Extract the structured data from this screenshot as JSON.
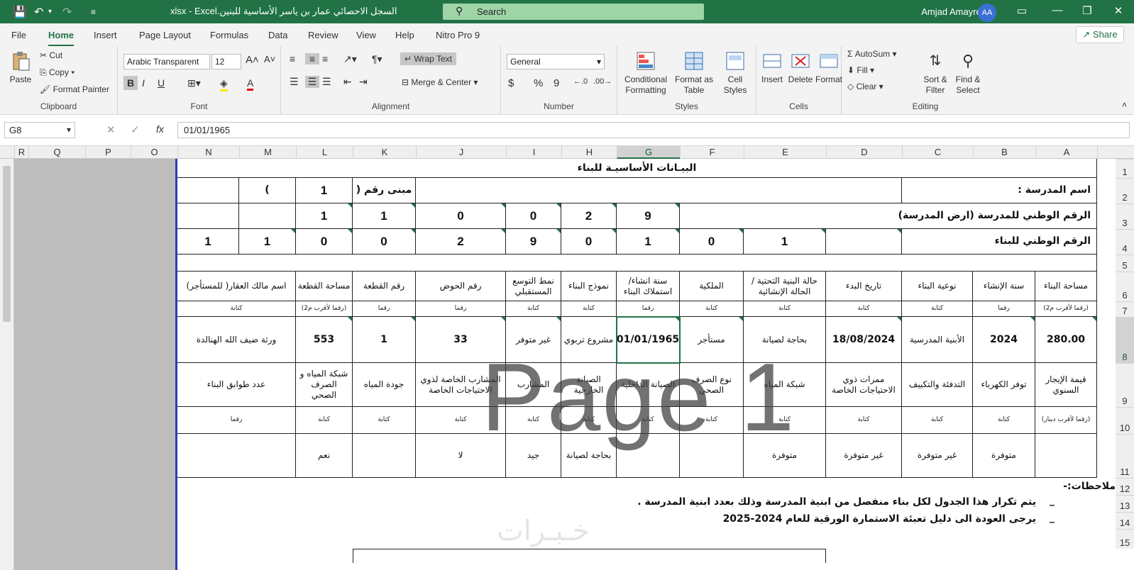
{
  "window": {
    "doc_title": "السجل الاحصائي عمار بن ياسر الأساسية للبنين.xlsx  -  Excel",
    "search_placeholder": "Search",
    "user_name": "Amjad Amayreh",
    "user_initials": "AA"
  },
  "menu": {
    "tabs": [
      "File",
      "Home",
      "Insert",
      "Page Layout",
      "Formulas",
      "Data",
      "Review",
      "View",
      "Help",
      "Nitro Pro 9"
    ],
    "active": "Home",
    "share": "Share"
  },
  "ribbon": {
    "clipboard": {
      "paste": "Paste",
      "cut": "Cut",
      "copy": "Copy",
      "format_painter": "Format Painter",
      "label": "Clipboard"
    },
    "font": {
      "name": "Arabic Transparent",
      "size": "12",
      "bold": "B",
      "italic": "I",
      "underline": "U",
      "label": "Font"
    },
    "alignment": {
      "wrap_text": "Wrap Text",
      "merge_center": "Merge & Center",
      "label": "Alignment"
    },
    "number": {
      "format": "General",
      "currency": "$",
      "percent": "%",
      "comma": "9",
      "label": "Number"
    },
    "styles": {
      "conditional": "Conditional Formatting",
      "format_table": "Format as Table",
      "cell_styles": "Cell Styles",
      "label": "Styles"
    },
    "cells": {
      "insert": "Insert",
      "delete": "Delete",
      "format": "Format",
      "label": "Cells"
    },
    "editing": {
      "autosum": "AutoSum",
      "fill": "Fill",
      "clear": "Clear",
      "sort_filter": "Sort & Filter",
      "find_select": "Find & Select",
      "label": "Editing"
    }
  },
  "formula_bar": {
    "name_box": "G8",
    "fx": "fx",
    "value": "01/01/1965"
  },
  "columns": [
    "R",
    "Q",
    "P",
    "O",
    "N",
    "M",
    "L",
    "K",
    "J",
    "I",
    "H",
    "G",
    "F",
    "E",
    "D",
    "C",
    "B",
    "A"
  ],
  "selected_column": "G",
  "rows": [
    "1",
    "2",
    "3",
    "4",
    "5",
    "6",
    "7",
    "8",
    "9",
    "10",
    "11",
    "12",
    "13",
    "14",
    "15"
  ],
  "selected_row": "8",
  "sheet": {
    "title": "البيـانات الأساسيـة للبناء",
    "school_name_label": "اسم المدرسة :",
    "building_no_label": "مبنى رقم (",
    "building_no": "1",
    "building_no_close": ")",
    "school_national_label": "الرقم الوطني للمدرسة (ارض المدرسة)",
    "school_national_digits": [
      "9",
      "2",
      "0",
      "0",
      "1",
      "1"
    ],
    "building_national_label": "الرقم الوطني للبناء",
    "building_national_digits": [
      "1",
      "0",
      "1",
      "0",
      "9",
      "2",
      "0",
      "0",
      "1",
      "1"
    ],
    "headers1": [
      "مساحة البناء",
      "سنة الإنشاء",
      "نوعية البناء",
      "تاريخ البدء",
      "حالة البنية التحتية / الحالة الإنشائية",
      "الملكية",
      "سنة انشاء/ استملاك البناء",
      "نموذج البناء",
      "نمط التوسع المستقبلي",
      "رقم الحوض",
      "رقم القطعة",
      "مساحة القطعة",
      "اسم مالك العقار( للمستأجر)"
    ],
    "types1": [
      "(رقما لأقرب م2)",
      "رقما",
      "كتابة",
      "كتابة",
      "كتابة",
      "كتابة",
      "رقما",
      "كتابة",
      "كتابة",
      "رقما",
      "رقما",
      "(رقما لأقرب م2)",
      "كتابة"
    ],
    "values1": [
      "280.00",
      "2024",
      "الأبنية المدرسية",
      "18/08/2024",
      "بحاجة لصيانة",
      "مستأجر",
      "01/01/1965",
      "مشروع تربوي",
      "غير متوفر",
      "33",
      "1",
      "553",
      "ورثة ضيف الله الهنالدة"
    ],
    "headers2": [
      "قيمة الإيجار السنوي",
      "توفر الكهرباء",
      "التدفئة والتكييف",
      "ممرات ذوي الاحتياجات الخاصة",
      "شبكة المياه",
      "نوع الصرف الصحي",
      "الصيانة الداخلية",
      "الصيانة الخارجية",
      "المشارب",
      "المشارب الخاصة لذوي الاحتياجات الخاصة",
      "جودة المياه",
      "شبكة المياه و الصرف الصحي",
      "عدد طوابق البناء"
    ],
    "types2": [
      "(رقما لأقرب دينار)",
      "كتابة",
      "كتابة",
      "كتابة",
      "كتابة",
      "كتابة",
      "كتابة",
      "كتابة",
      "كتابة",
      "كتابة",
      "كتابة",
      "كتابة",
      "رقما"
    ],
    "values2": [
      "",
      "متوفرة",
      "غير متوفرة",
      "غير متوفرة",
      "متوفرة",
      "",
      "",
      "بحاجة لصيانة",
      "جيد",
      "لا",
      "",
      "نعم",
      ""
    ],
    "notes_label": "ملاحظات:-",
    "note1": "يتم تكرار هذا الجدول لكل بناء منفصل من ابنية المدرسة وذلك بعدد ابنية المدرسة .",
    "note2": "يرجى العودة الى  دليل تعبئة الاستمارة الورقية للعام 2024-2025",
    "dash": "_",
    "watermark": "Page 1"
  }
}
